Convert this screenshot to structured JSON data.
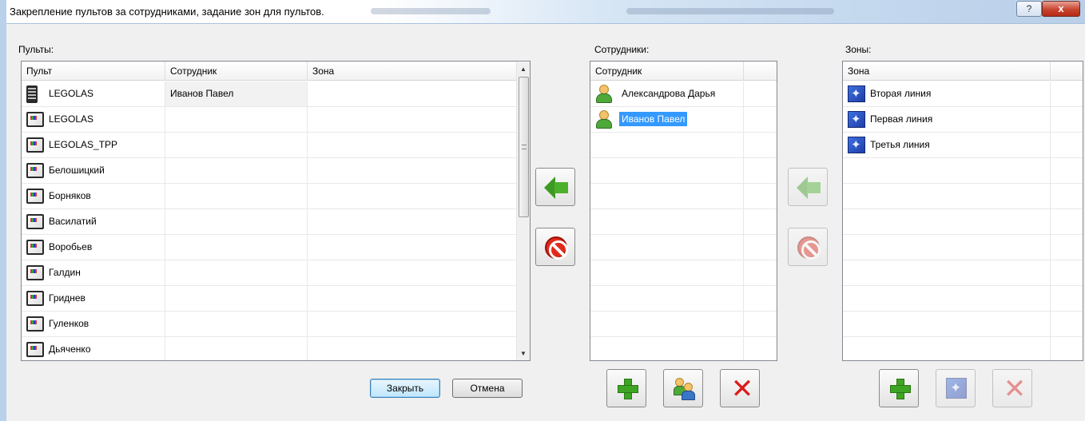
{
  "window": {
    "title": "Закрепление пультов за сотрудниками, задание зон для пультов.",
    "help_label": "?",
    "close_label": "x"
  },
  "consoles": {
    "label": "Пульты:",
    "columns": [
      "Пульт",
      "Сотрудник",
      "Зона"
    ],
    "rows": [
      {
        "name": "LEGOLAS",
        "employee": "Иванов Павел",
        "zone": "",
        "icon": "phone-icon"
      },
      {
        "name": "LEGOLAS",
        "employee": "",
        "zone": "",
        "icon": "terminal-icon"
      },
      {
        "name": "LEGOLAS_TPP",
        "employee": "",
        "zone": "",
        "icon": "terminal-icon"
      },
      {
        "name": "Белошицкий",
        "employee": "",
        "zone": "",
        "icon": "terminal-icon"
      },
      {
        "name": "Борняков",
        "employee": "",
        "zone": "",
        "icon": "terminal-icon"
      },
      {
        "name": "Василатий",
        "employee": "",
        "zone": "",
        "icon": "terminal-icon"
      },
      {
        "name": "Воробьев",
        "employee": "",
        "zone": "",
        "icon": "terminal-icon"
      },
      {
        "name": "Галдин",
        "employee": "",
        "zone": "",
        "icon": "terminal-icon"
      },
      {
        "name": "Гриднев",
        "employee": "",
        "zone": "",
        "icon": "terminal-icon"
      },
      {
        "name": "Гуленков",
        "employee": "",
        "zone": "",
        "icon": "terminal-icon"
      },
      {
        "name": "Дьяченко",
        "employee": "",
        "zone": "",
        "icon": "terminal-icon"
      }
    ]
  },
  "employees": {
    "label": "Сотрудники:",
    "column": "Сотрудник",
    "rows": [
      {
        "name": "Александрова Дарья",
        "selected": false
      },
      {
        "name": "Иванов Павел",
        "selected": true
      }
    ]
  },
  "zones": {
    "label": "Зоны:",
    "column": "Зона",
    "rows": [
      "Вторая линия",
      "Первая линия",
      "Третья линия"
    ]
  },
  "buttons": {
    "ok": "Закрыть",
    "cancel": "Отмена"
  },
  "colors": {
    "selection": "#3399ff",
    "accent_green": "#3da523",
    "delete_red": "#d91b1b"
  }
}
